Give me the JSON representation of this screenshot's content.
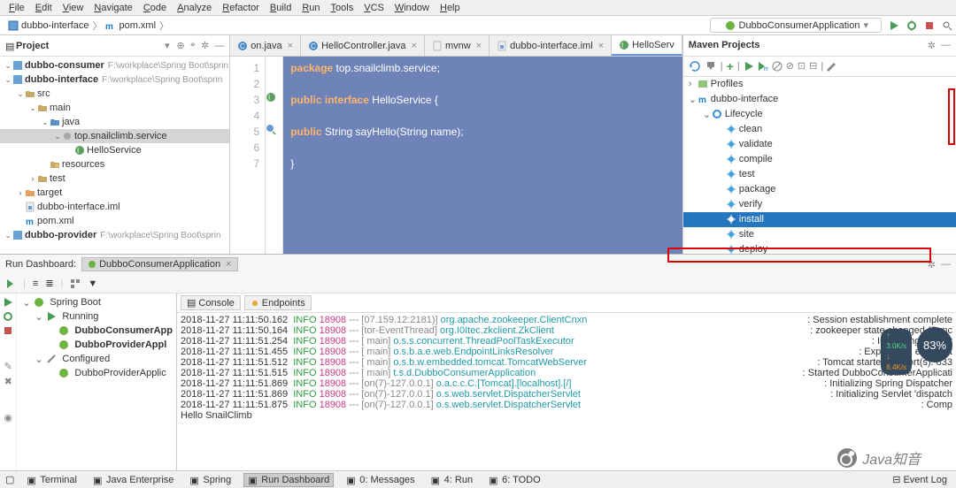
{
  "menu": {
    "items": [
      "File",
      "Edit",
      "View",
      "Navigate",
      "Code",
      "Analyze",
      "Refactor",
      "Build",
      "Run",
      "Tools",
      "VCS",
      "Window",
      "Help"
    ]
  },
  "breadcrumb": {
    "module": "dubbo-interface",
    "file": "pom.xml"
  },
  "run_config": {
    "selected": "DubboConsumerApplication"
  },
  "project": {
    "title": "Project",
    "rows": [
      {
        "indent": 0,
        "arrow": "v",
        "icon": "module",
        "name": "dubbo-consumer",
        "path": "F:\\workplace\\Spring Boot\\sprin"
      },
      {
        "indent": 0,
        "arrow": "v",
        "icon": "module",
        "name": "dubbo-interface",
        "path": "F:\\workplace\\Spring Boot\\sprin"
      },
      {
        "indent": 1,
        "arrow": "v",
        "icon": "folder",
        "name": "src"
      },
      {
        "indent": 2,
        "arrow": "v",
        "icon": "folder",
        "name": "main"
      },
      {
        "indent": 3,
        "arrow": "v",
        "icon": "srcfolder",
        "name": "java"
      },
      {
        "indent": 4,
        "arrow": "v",
        "icon": "package",
        "name": "top.snailclimb.service",
        "sel": true
      },
      {
        "indent": 5,
        "arrow": "",
        "icon": "interface",
        "name": "HelloService"
      },
      {
        "indent": 3,
        "arrow": "",
        "icon": "resfolder",
        "name": "resources"
      },
      {
        "indent": 2,
        "arrow": ">",
        "icon": "folder",
        "name": "test"
      },
      {
        "indent": 1,
        "arrow": ">",
        "icon": "target",
        "name": "target"
      },
      {
        "indent": 1,
        "arrow": "",
        "icon": "iml",
        "name": "dubbo-interface.iml"
      },
      {
        "indent": 1,
        "arrow": "",
        "icon": "maven",
        "name": "pom.xml"
      },
      {
        "indent": 0,
        "arrow": "v",
        "icon": "module",
        "name": "dubbo-provider",
        "path": "F:\\workplace\\Spring Boot\\sprin"
      }
    ]
  },
  "editor": {
    "tabs": [
      {
        "label": "on.java",
        "icon": "class",
        "close": true
      },
      {
        "label": "HelloController.java",
        "icon": "class",
        "close": true
      },
      {
        "label": "mvnw",
        "icon": "file",
        "close": true
      },
      {
        "label": "dubbo-interface.iml",
        "icon": "iml",
        "close": true
      },
      {
        "label": "HelloServ",
        "icon": "interface",
        "active": true
      }
    ],
    "code": {
      "line_numbers": [
        1,
        2,
        3,
        4,
        5,
        6,
        7
      ],
      "lines": [
        {
          "text": [
            {
              "t": "package",
              "cls": "kw"
            },
            {
              "t": " top.snailclimb.service;"
            }
          ]
        },
        {
          "text": []
        },
        {
          "text": [
            {
              "t": "public interface",
              "cls": "kw"
            },
            {
              "t": " HelloService {"
            }
          ]
        },
        {
          "text": []
        },
        {
          "text": [
            {
              "t": "    public",
              "cls": "kw"
            },
            {
              "t": "  String sayHello(String name);"
            }
          ]
        },
        {
          "text": []
        },
        {
          "text": [
            {
              "t": "}"
            }
          ]
        }
      ]
    }
  },
  "maven": {
    "title": "Maven Projects",
    "rows": [
      {
        "indent": 0,
        "arrow": ">",
        "icon": "profiles",
        "label": "Profiles"
      },
      {
        "indent": 0,
        "arrow": "v",
        "icon": "maven",
        "label": "dubbo-interface"
      },
      {
        "indent": 1,
        "arrow": "v",
        "icon": "lifecycle",
        "label": "Lifecycle"
      },
      {
        "indent": 2,
        "arrow": "",
        "icon": "goal",
        "label": "clean"
      },
      {
        "indent": 2,
        "arrow": "",
        "icon": "goal",
        "label": "validate"
      },
      {
        "indent": 2,
        "arrow": "",
        "icon": "goal",
        "label": "compile"
      },
      {
        "indent": 2,
        "arrow": "",
        "icon": "goal",
        "label": "test"
      },
      {
        "indent": 2,
        "arrow": "",
        "icon": "goal",
        "label": "package"
      },
      {
        "indent": 2,
        "arrow": "",
        "icon": "goal",
        "label": "verify"
      },
      {
        "indent": 2,
        "arrow": "",
        "icon": "goal",
        "label": "install",
        "sel": true
      },
      {
        "indent": 2,
        "arrow": "",
        "icon": "goal",
        "label": "site"
      },
      {
        "indent": 2,
        "arrow": "",
        "icon": "goal",
        "label": "deploy"
      }
    ]
  },
  "dashboard": {
    "title": "Run Dashboard:",
    "tab": "DubboConsumerApplication",
    "tree": [
      {
        "indent": 0,
        "arrow": "v",
        "icon": "spring",
        "label": "Spring Boot"
      },
      {
        "indent": 1,
        "arrow": "v",
        "icon": "run",
        "label": "Running"
      },
      {
        "indent": 2,
        "arrow": "",
        "icon": "spring",
        "label": "DubboConsumerApp",
        "bold": true
      },
      {
        "indent": 2,
        "arrow": "",
        "icon": "spring",
        "label": "DubboProviderAppl",
        "bold": true
      },
      {
        "indent": 1,
        "arrow": "v",
        "icon": "conf",
        "label": "Configured"
      },
      {
        "indent": 2,
        "arrow": "",
        "icon": "spring",
        "label": "DubboProviderApplic"
      }
    ],
    "console_tabs": [
      "Console",
      "Endpoints"
    ],
    "lines": [
      {
        "ts": "2018-11-27 11:11:50.162",
        "lvl": "INFO",
        "pid": "18908",
        "thread": "[07.159.12:2181)]",
        "cls": "org.apache.zookeeper.ClientCnxn",
        "msg": ": Session establishment complete"
      },
      {
        "ts": "2018-11-27 11:11:50.164",
        "lvl": "INFO",
        "pid": "18908",
        "thread": "[tor-EventThread]",
        "cls": "org.I0Itec.zkclient.ZkClient",
        "msg": ": zookeeper state changed (Sync"
      },
      {
        "ts": "2018-11-27 11:11:51.254",
        "lvl": "INFO",
        "pid": "18908",
        "thread": "[           main]",
        "cls": "o.s.s.concurrent.ThreadPoolTaskExecutor",
        "msg": ": Initializing Execut"
      },
      {
        "ts": "2018-11-27 11:11:51.455",
        "lvl": "INFO",
        "pid": "18908",
        "thread": "[           main]",
        "cls": "o.s.b.a.e.web.EndpointLinksResolver",
        "msg": ": Exposing 2 endpoint"
      },
      {
        "ts": "2018-11-27 11:11:51.512",
        "lvl": "INFO",
        "pid": "18908",
        "thread": "[           main]",
        "cls": "o.s.b.w.embedded.tomcat.TomcatWebServer",
        "msg": ": Tomcat started on port(s): 833"
      },
      {
        "ts": "2018-11-27 11:11:51.515",
        "lvl": "INFO",
        "pid": "18908",
        "thread": "[           main]",
        "cls": "t.s.d.DubboConsumerApplication",
        "msg": ": Started DubboConsumerApplicati"
      },
      {
        "ts": "2018-11-27 11:11:51.869",
        "lvl": "INFO",
        "pid": "18908",
        "thread": "[on(7)-127.0.0.1]",
        "cls": "o.a.c.c.C.[Tomcat].[localhost].[/]",
        "msg": ": Initializing Spring Dispatcher"
      },
      {
        "ts": "2018-11-27 11:11:51.869",
        "lvl": "INFO",
        "pid": "18908",
        "thread": "[on(7)-127.0.0.1]",
        "cls": "o.s.web.servlet.DispatcherServlet",
        "msg": ": Initializing Servlet 'dispatch"
      },
      {
        "ts": "2018-11-27 11:11:51.875",
        "lvl": "INFO",
        "pid": "18908",
        "thread": "[on(7)-127.0.0.1]",
        "cls": "o.s.web.servlet.DispatcherServlet",
        "msg": ": Comp"
      }
    ],
    "final_text": "Hello SnailClimb"
  },
  "status": {
    "items": [
      {
        "icon": "terminal",
        "label": "Terminal"
      },
      {
        "icon": "javaee",
        "label": "Java Enterprise"
      },
      {
        "icon": "spring",
        "label": "Spring"
      },
      {
        "icon": "run",
        "label": "Run Dashboard",
        "sel": true
      },
      {
        "icon": "messages",
        "label": "0: Messages"
      },
      {
        "icon": "run2",
        "label": "4: Run"
      },
      {
        "icon": "todo",
        "label": "6: TODO"
      }
    ],
    "right": "Event Log"
  },
  "badge": {
    "percent": "83%",
    "up": "3.0K/s",
    "down": "6.4K/s"
  },
  "watermark": "Java知音"
}
